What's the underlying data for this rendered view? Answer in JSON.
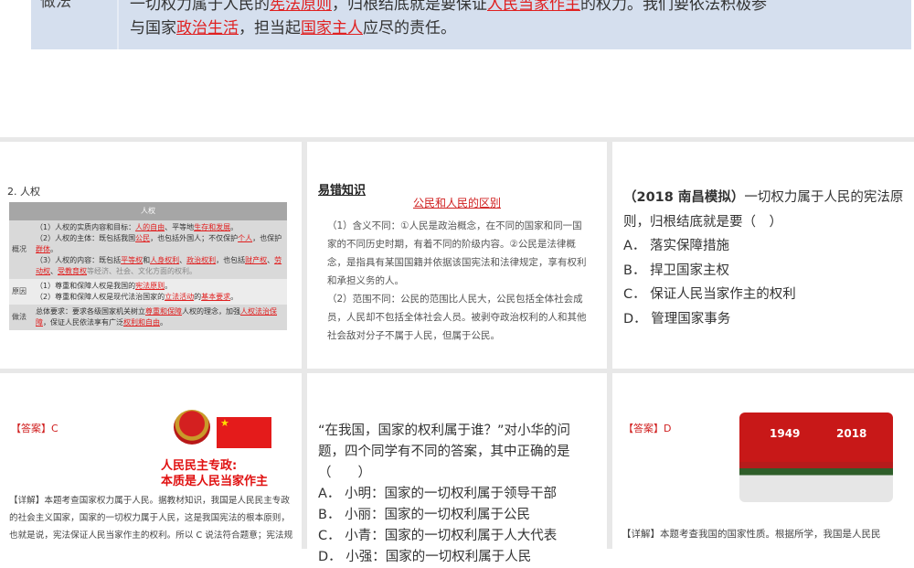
{
  "top_slide": {
    "label": "做法",
    "line1_a": "一切权力属于人民的",
    "line1_b": "宪法原则",
    "line1_c": "，归根结底就是要保证",
    "line1_d": "人民当家作主",
    "line1_e": "的权力。我们要依法积极参",
    "line2_a": "与国家",
    "line2_b": "政治生活",
    "line2_c": "，担当起",
    "line2_d": "国家主人",
    "line2_e": "应尽的责任。"
  },
  "human_rights": {
    "heading": "2. 人权",
    "table_title": "人权",
    "rows": [
      {
        "key": "概况",
        "l1a": "（1）人权的实质内容和目标：",
        "l1b": "人的自由",
        "l1c": "、平等地",
        "l1d": "生存和发展",
        "l1e": "。",
        "l2a": "（2）人权的主体：既包括我国",
        "l2b": "公民",
        "l2c": "，也包括外国人；不仅保护",
        "l2d": "个人",
        "l2e": "，也保护",
        "l2f": "群体",
        "l2g": "。",
        "l3a": "（3）人权的内容：既包括",
        "l3b": "平等权",
        "l3c": "和",
        "l3d": "人身权利",
        "l3e": "、",
        "l3f": "政治权利",
        "l3g": "，也包括",
        "l3h": "财产权",
        "l3i": "、",
        "l3j": "劳动权",
        "l3k": "、",
        "l3l": "受教育权",
        "l3m": "等经济、社会、文化方面的权利。"
      },
      {
        "key": "原因",
        "l1a": "（1）尊重和保障人权是我国的",
        "l1b": "宪法原则",
        "l1c": "。",
        "l2a": "（2）尊重和保障人权是现代法治国家的",
        "l2b": "立法活动",
        "l2c": "的",
        "l2d": "基本要求",
        "l2e": "。"
      },
      {
        "key": "做法",
        "l1a": "总体要求：要求各级国家机关树立",
        "l1b": "尊重和保障",
        "l1c": "人权的理念，加强",
        "l1d": "人权法治保障",
        "l1e": "，保证人民依法享有广泛",
        "l1f": "权利和自由",
        "l1g": "。"
      }
    ]
  },
  "mistakes": {
    "label": "易错知识",
    "title": "公民和人民的区别",
    "p1": "（1）含义不同：①人民是政治概念，在不同的国家和同一国家的不同历史时期，有着不同的阶级内容。②公民是法律概念，是指具有某国国籍并依据该国宪法和法律规定，享有权利和承担义务的人。",
    "p2": "（2）范围不同：公民的范围比人民大，公民包括全体社会成员，人民却不包括全体社会人员。被剥夺政治权利的人和其他社会敌对分子不属于人民，但属于公民。"
  },
  "question1": {
    "source": "（2018 南昌模拟）",
    "stem": "一切权力属于人民的宪法原则，归根结底就是要（　）",
    "options": [
      "A．  落实保障措施",
      "B．  捍卫国家主权",
      "C．  保证人民当家作主的权利",
      "D．  管理国家事务"
    ]
  },
  "answer1": {
    "answer": "【答案】C",
    "slogan1": "人民民主专政:",
    "slogan2": "本质是人民当家作主",
    "detail": "【详解】本题考查国家权力属于人民。据教材知识，我国是人民民主专政的社会主义国家，国家的一切权力属于人民，这是我国宪法的根本原则，也就是说，宪法保证人民当家作主的权利。所以 C 说法符合题意；宪法规"
  },
  "question2": {
    "stem": "“在我国，国家的权利属于谁？”对小华的问题，四个同学有不同的答案，其中正确的是（　　）",
    "options": [
      "A．  小明：国家的一切权利属于领导干部",
      "B．  小丽：国家的一切权利属于公民",
      "C．  小青：国家的一切权利属于人大代表",
      "D．  小强：国家的一切权利属于人民"
    ]
  },
  "answer2": {
    "answer": "【答案】D",
    "year1": "1949",
    "year2": "2018",
    "detail": "【详解】本题考查我国的国家性质。根据所学，我国是人民民"
  }
}
